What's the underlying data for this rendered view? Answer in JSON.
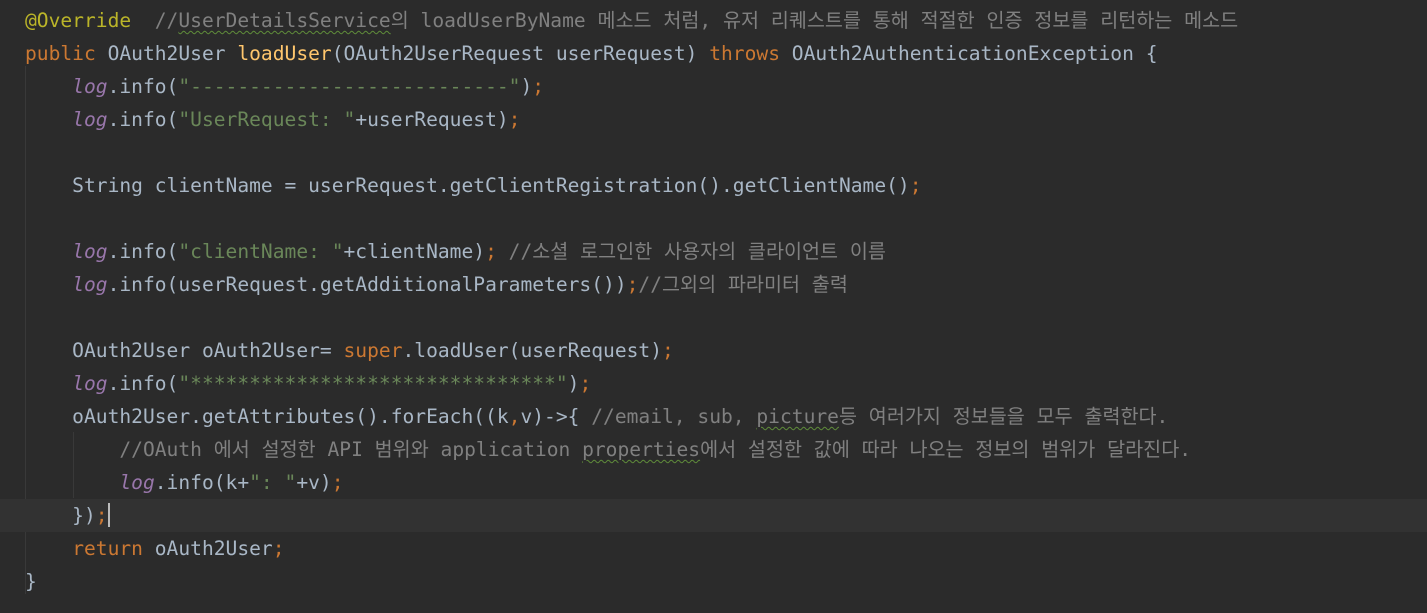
{
  "lines": [
    [
      "@Override",
      "  //",
      "UserDetailsService",
      "의 loadUserByName 메소드 처럼, 유저 리퀘스트를 통해 적절한 인증 정보를 리턴하는 메소드"
    ],
    [
      "public",
      " OAuth2User ",
      "loadUser",
      "(OAuth2UserRequest userRequest) ",
      "throws",
      " OAuth2AuthenticationException {"
    ],
    [
      "    ",
      "log",
      ".info(",
      "\"---------------------------\"",
      ")",
      ";"
    ],
    [
      "    ",
      "log",
      ".info(",
      "\"UserRequest: \"",
      "+userRequest)",
      ";"
    ],
    [
      ""
    ],
    [
      "    String clientName = userRequest.getClientRegistration().getClientName()",
      ";"
    ],
    [
      ""
    ],
    [
      "    ",
      "log",
      ".info(",
      "\"clientName: \"",
      "+clientName)",
      ";",
      " //소셜 로그인한 사용자의 클라이언트 이름"
    ],
    [
      "    ",
      "log",
      ".info(userRequest.getAdditionalParameters())",
      ";",
      "//그외의 파라미터 출력"
    ],
    [
      ""
    ],
    [
      "    OAuth2User oAuth2User= ",
      "super",
      ".loadUser(userRequest)",
      ";"
    ],
    [
      "    ",
      "log",
      ".info(",
      "\"*******************************\"",
      ")",
      ";"
    ],
    [
      "    oAuth2User.getAttributes().forEach((k",
      ",",
      "v)->{ ",
      "//email, sub, ",
      "picture",
      "등 여러가지 정보들을 모두 출력한다."
    ],
    [
      "        ",
      "//OAuth 에서 설정한 API 범위와 application ",
      "properties",
      "에서 설정한 값에 따라 나오는 정보의 범위가 달라진다."
    ],
    [
      "        ",
      "log",
      ".info(k+",
      "\": \"",
      "+v)",
      ";"
    ],
    [
      "    })",
      ";"
    ],
    [
      "    ",
      "return",
      " oAuth2User",
      ";"
    ],
    [
      "}"
    ]
  ],
  "colors": {
    "background": "#2b2b2b",
    "current_line": "#323232",
    "default_text": "#a9b7c6",
    "keyword": "#cc7832",
    "annotation": "#bbb529",
    "method_declaration": "#ffc66d",
    "string": "#6a8759",
    "comment": "#808080",
    "static_field": "#9876aa"
  }
}
